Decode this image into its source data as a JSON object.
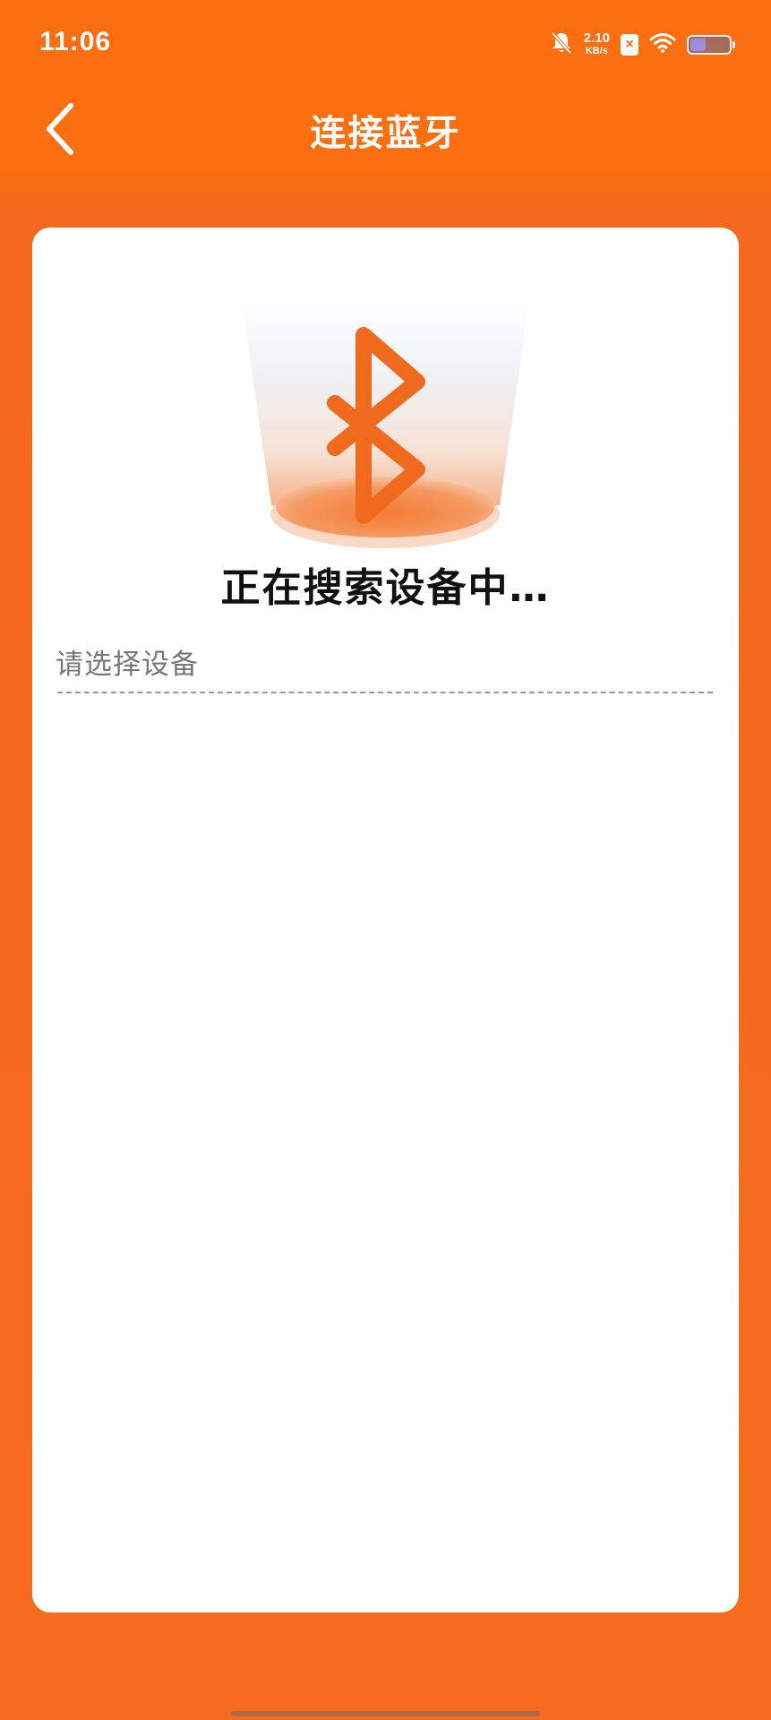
{
  "status_bar": {
    "time": "11:06",
    "net_speed_value": "2.10",
    "net_speed_unit": "KB/s",
    "sim_badge": "×",
    "icons": [
      "bell-off-icon",
      "sim-no-service-icon",
      "wifi-icon",
      "battery-icon"
    ],
    "battery_level_fraction": 0.4
  },
  "header": {
    "title": "连接蓝牙",
    "back_icon": "chevron-left-icon"
  },
  "main": {
    "illustration_icon": "bluetooth-icon",
    "search_status": "正在搜索设备中…",
    "select_label": "请选择设备",
    "devices": []
  },
  "colors": {
    "brand_orange": "#fb6f10",
    "background_orange": "#f66c1f",
    "card_white": "#ffffff"
  }
}
